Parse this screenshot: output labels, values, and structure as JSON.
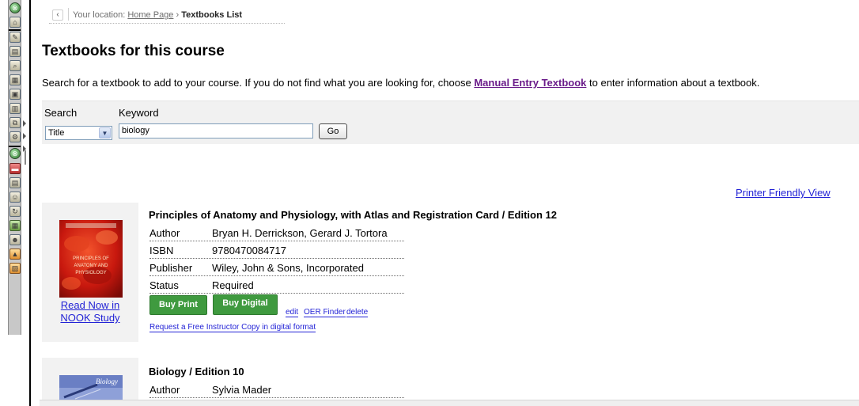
{
  "breadcrumb": {
    "prefix": "Your location:",
    "home": "Home Page",
    "separator": "›",
    "current": "Textbooks List"
  },
  "page_title": "Textbooks for this course",
  "intro": {
    "before": "Search for a textbook to add to your course. If you do not find what you are looking for, choose ",
    "link": "Manual Entry Textbook",
    "after": " to enter information about a textbook."
  },
  "search": {
    "search_label": "Search",
    "keyword_label": "Keyword",
    "field_selected": "Title",
    "keyword_value": "biology",
    "go_label": "Go"
  },
  "printer_link": "Printer Friendly View",
  "books": [
    {
      "title": "Principles of Anatomy and Physiology, with Atlas and Registration Card / Edition 12",
      "rows": [
        {
          "k": "Author",
          "v": "Bryan H. Derrickson, Gerard J. Tortora"
        },
        {
          "k": "ISBN",
          "v": "9780470084717"
        },
        {
          "k": "Publisher",
          "v": "Wiley, John & Sons, Incorporated"
        },
        {
          "k": "Status",
          "v": "Required"
        }
      ],
      "read_now_1": "Read Now in",
      "read_now_2": "NOOK Study",
      "buy_print": "Buy Print",
      "buy_digital": "Buy Digital",
      "edit": "edit",
      "oer": "OER Finder",
      "delete": "delete",
      "request": "Request a Free Instructor Copy in digital format",
      "cover_text": "PRINCIPLES OF ANATOMY AND PHYSIOLOGY"
    },
    {
      "title": "Biology / Edition 10",
      "rows": [
        {
          "k": "Author",
          "v": "Sylvia Mader"
        }
      ],
      "cover_text": "Biology"
    }
  ],
  "colors": {
    "link": "#2323d6",
    "manual_link": "#6a1b8a",
    "buy_button": "#3f9a3f",
    "panel": "#f1f1f1"
  }
}
